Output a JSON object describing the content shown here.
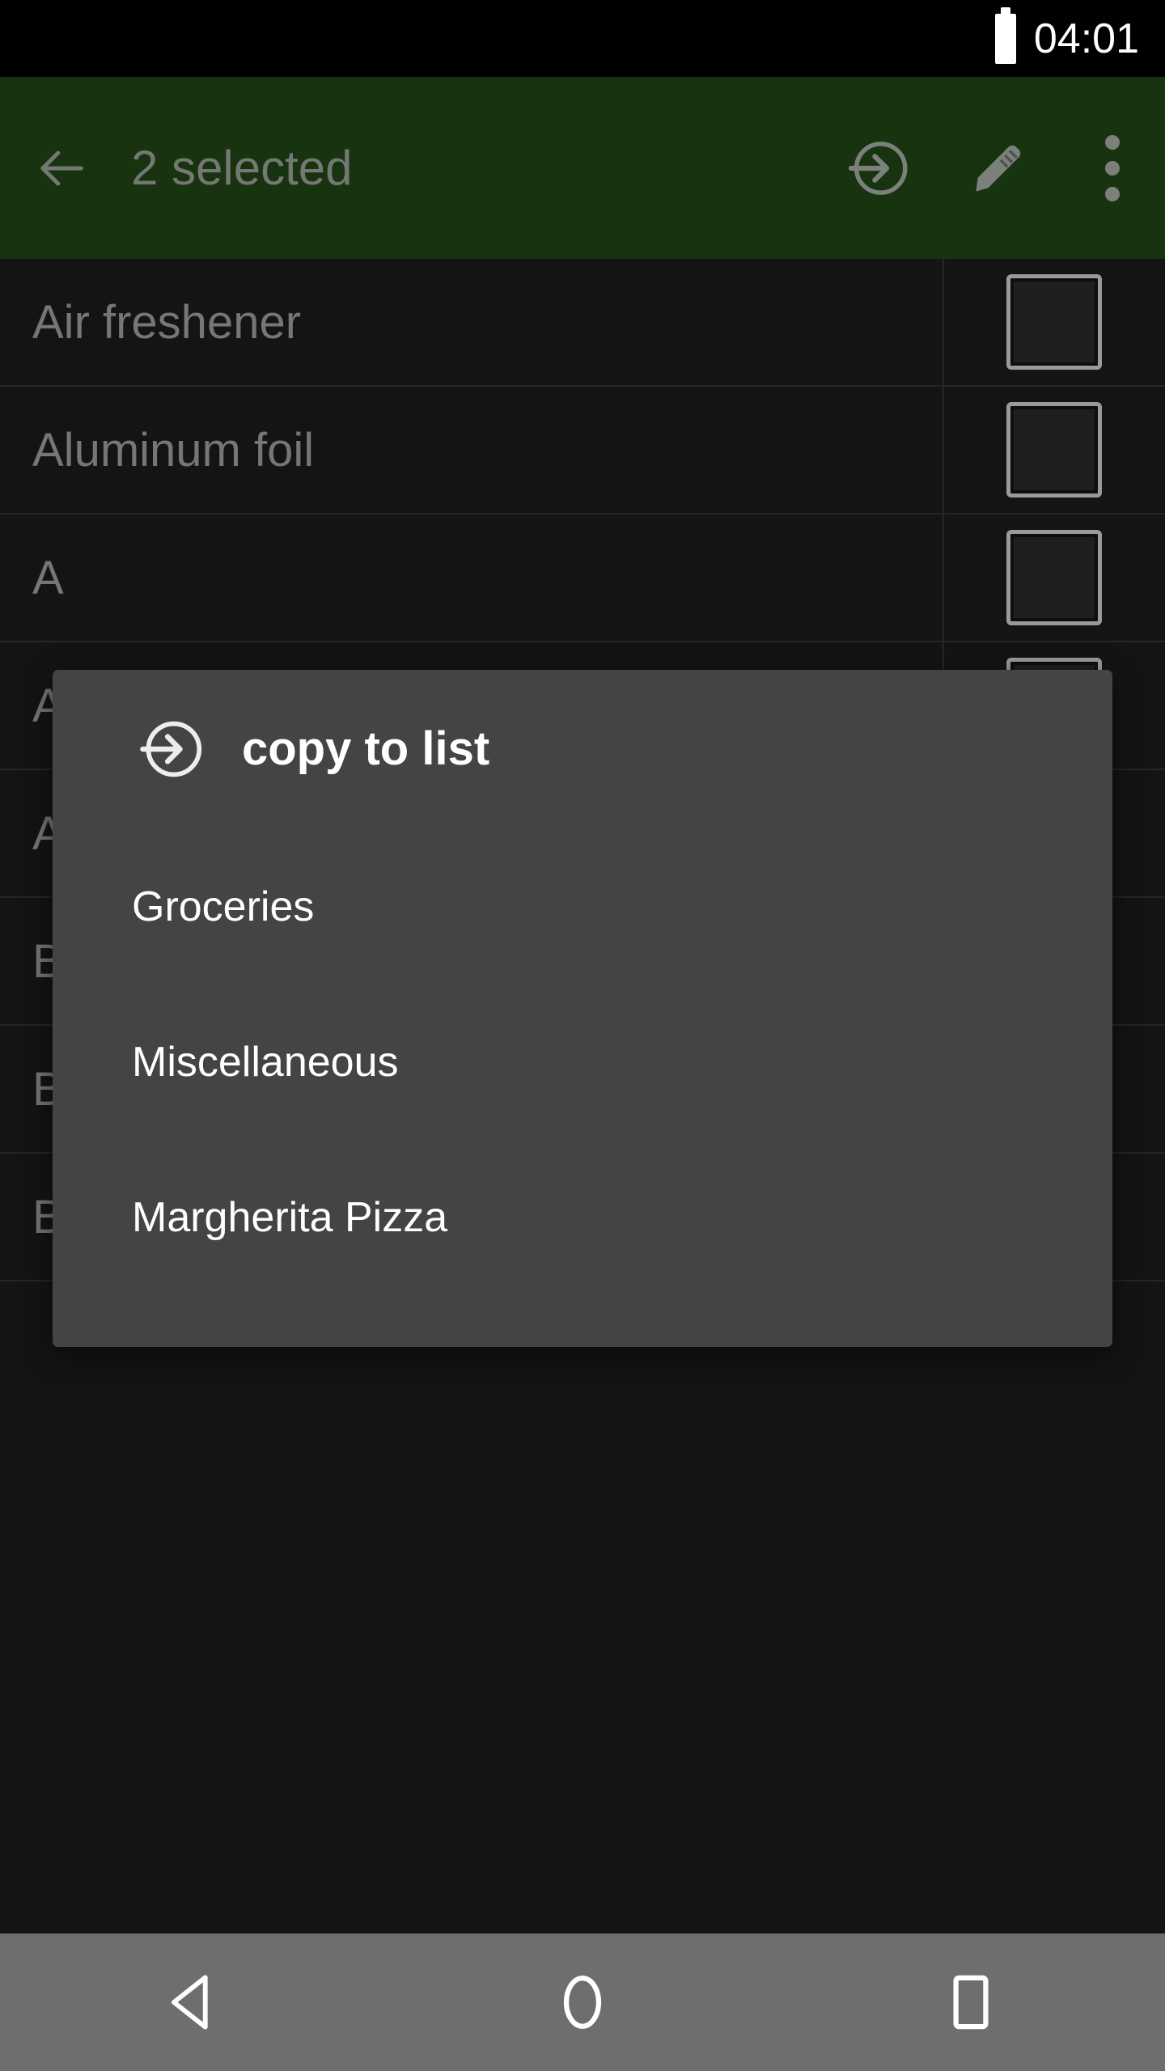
{
  "status_bar": {
    "time": "04:01",
    "battery_icon": "battery-full-icon"
  },
  "action_bar": {
    "background_color": "#17330f",
    "back_icon": "arrow-left-icon",
    "title": "2 selected",
    "actions": [
      {
        "icon": "copy-to-list-icon",
        "label": "copy to list"
      },
      {
        "icon": "pencil-edit-icon",
        "label": "edit"
      },
      {
        "icon": "overflow-menu-icon",
        "label": "more options"
      }
    ]
  },
  "list": {
    "items": [
      {
        "label": "Air freshener",
        "checked": false
      },
      {
        "label": "Aluminum foil",
        "checked": false
      },
      {
        "label": "A",
        "checked": false
      },
      {
        "label": "A",
        "checked": false
      },
      {
        "label": "A",
        "checked": false
      },
      {
        "label": "Bacon",
        "checked": false
      },
      {
        "label": "Bagels",
        "checked": true
      },
      {
        "label": "Baking powder",
        "checked": false
      }
    ],
    "check_color": "#5f8f22"
  },
  "dialog": {
    "icon": "copy-to-list-icon",
    "title": "copy to list",
    "background_color": "#444444",
    "options": [
      {
        "label": "Groceries"
      },
      {
        "label": "Miscellaneous"
      },
      {
        "label": "Margherita Pizza"
      }
    ]
  },
  "nav_bar": {
    "background_color": "#6e6e6e",
    "buttons": [
      {
        "icon": "nav-back-icon",
        "label": "Back"
      },
      {
        "icon": "nav-home-icon",
        "label": "Home"
      },
      {
        "icon": "nav-recents-icon",
        "label": "Recents"
      }
    ]
  }
}
